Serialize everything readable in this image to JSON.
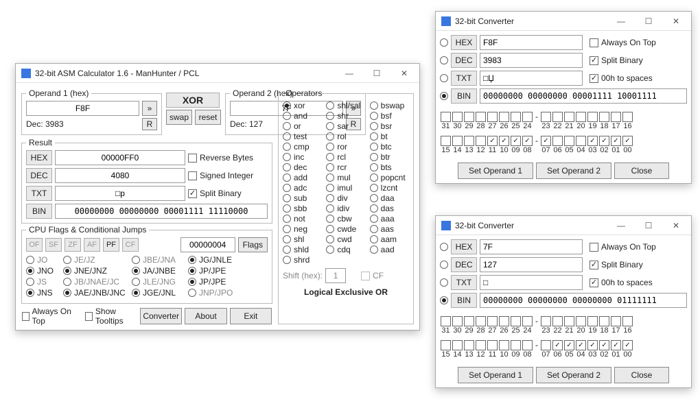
{
  "mainWin": {
    "title": "32-bit ASM Calculator 1.6 - ManHunter / PCL",
    "operand1": {
      "legend": "Operand 1 (hex)",
      "value": "F8F",
      "dec": "Dec: 3983",
      "btnR": "R",
      "btnArrow": "»"
    },
    "operator": {
      "label": "XOR",
      "swap": "swap",
      "reset": "reset"
    },
    "operand2": {
      "legend": "Operand 2 (hex)",
      "value": "7F",
      "dec": "Dec: 127",
      "btnR": "R",
      "btnArrow": "»"
    },
    "result": {
      "legend": "Result",
      "hexLabel": "HEX",
      "hex": "00000FF0",
      "decLabel": "DEC",
      "dec": "4080",
      "txtLabel": "TXT",
      "txt": "□p",
      "binLabel": "BIN",
      "bin": "00000000 00000000 00001111 11110000",
      "reverse": "Reverse Bytes",
      "signed": "Signed Integer",
      "split": "Split Binary"
    },
    "cpu": {
      "legend": "CPU Flags & Conditional Jumps",
      "flags": [
        "OF",
        "SF",
        "ZF",
        "AF",
        "PF",
        "CF"
      ],
      "activeFlags": [
        "PF"
      ],
      "counter": "00000004",
      "flagsBtn": "Flags",
      "jumps": [
        [
          [
            "JO",
            false
          ],
          [
            "JE/JZ",
            false
          ],
          [
            "JBE/JNA",
            false
          ],
          [
            "JG/JNLE",
            true
          ]
        ],
        [
          [
            "JNO",
            true
          ],
          [
            "JNE/JNZ",
            true
          ],
          [
            "JA/JNBE",
            true
          ],
          [
            "JP/JPE",
            true
          ]
        ],
        [
          [
            "JS",
            false
          ],
          [
            "JB/JNAE/JC",
            false
          ],
          [
            "JLE/JNG",
            false
          ],
          [
            "JP/JPE",
            true
          ]
        ],
        [
          [
            "JNS",
            true
          ],
          [
            "JAE/JNB/JNC",
            true
          ],
          [
            "JGE/JNL",
            true
          ],
          [
            "JNP/JPO",
            false
          ]
        ]
      ]
    },
    "operators": {
      "legend": "Operators",
      "list": [
        "xor",
        "and",
        "or",
        "test",
        "cmp",
        "inc",
        "dec",
        "add",
        "adc",
        "sub",
        "sbb",
        "not",
        "neg",
        "shl",
        "shld",
        "shrd",
        "shl/sal",
        "shr",
        "sar",
        "rol",
        "ror",
        "rcl",
        "rcr",
        "mul",
        "imul",
        "div",
        "idiv",
        "cbw",
        "cwde",
        "cwd",
        "cdq",
        "bswap",
        "bsf",
        "bsr",
        "bt",
        "btc",
        "btr",
        "bts",
        "popcnt",
        "lzcnt",
        "daa",
        "das",
        "aaa",
        "aas",
        "aam",
        "aad"
      ],
      "cols": [
        [
          "xor",
          "and",
          "or",
          "test",
          "cmp",
          "inc",
          "dec",
          "add",
          "adc",
          "sub",
          "sbb",
          "not",
          "neg",
          "shl",
          "shld",
          "shrd"
        ],
        [
          "shl/sal",
          "shr",
          "sar",
          "rol",
          "ror",
          "rcl",
          "rcr",
          "mul",
          "imul",
          "div",
          "idiv",
          "cbw",
          "cwde",
          "cwd",
          "cdq"
        ],
        [
          "bswap",
          "bsf",
          "bsr",
          "bt",
          "btc",
          "btr",
          "bts",
          "popcnt",
          "lzcnt",
          "daa",
          "das",
          "aaa",
          "aas",
          "aam",
          "aad"
        ]
      ],
      "selected": "xor",
      "shiftLabel": "Shift (hex):",
      "shiftVal": "1",
      "cfLabel": "CF",
      "desc": "Logical Exclusive OR"
    },
    "bottom": {
      "alwaysOnTop": "Always On Top",
      "tooltips": "Show Tooltips",
      "converter": "Converter",
      "about": "About",
      "exit": "Exit"
    }
  },
  "convA": {
    "title": "32-bit Converter",
    "hex": "F8F",
    "dec": "3983",
    "txt": "□Џ",
    "bin": "00000000 00000000 00001111 10001111",
    "alwaysOnTop": "Always On Top",
    "split": "Split Binary",
    "zeroH": "00h to spaces",
    "labels": {
      "hex": "HEX",
      "dec": "DEC",
      "txt": "TXT",
      "bin": "BIN"
    },
    "bitsHigh": [
      0,
      0,
      0,
      0,
      0,
      0,
      0,
      0,
      0,
      0,
      0,
      0,
      0,
      0,
      0,
      0
    ],
    "bitsLow": [
      0,
      0,
      0,
      0,
      1,
      1,
      1,
      1,
      1,
      0,
      0,
      0,
      1,
      1,
      1,
      1
    ],
    "highLbl": [
      "31",
      "30",
      "29",
      "28",
      "27",
      "26",
      "25",
      "24",
      "23",
      "22",
      "21",
      "20",
      "19",
      "18",
      "17",
      "16"
    ],
    "lowLbl": [
      "15",
      "14",
      "13",
      "12",
      "11",
      "10",
      "09",
      "08",
      "07",
      "06",
      "05",
      "04",
      "03",
      "02",
      "01",
      "00"
    ],
    "set1": "Set Operand 1",
    "set2": "Set Operand 2",
    "close": "Close",
    "selectedRow": 3
  },
  "convB": {
    "title": "32-bit Converter",
    "hex": "7F",
    "dec": "127",
    "txt": "□",
    "bin": "00000000 00000000 00000000 01111111",
    "alwaysOnTop": "Always On Top",
    "split": "Split Binary",
    "zeroH": "00h to spaces",
    "labels": {
      "hex": "HEX",
      "dec": "DEC",
      "txt": "TXT",
      "bin": "BIN"
    },
    "bitsHigh": [
      0,
      0,
      0,
      0,
      0,
      0,
      0,
      0,
      0,
      0,
      0,
      0,
      0,
      0,
      0,
      0
    ],
    "bitsLow": [
      0,
      0,
      0,
      0,
      0,
      0,
      0,
      0,
      0,
      1,
      1,
      1,
      1,
      1,
      1,
      1
    ],
    "highLbl": [
      "31",
      "30",
      "29",
      "28",
      "27",
      "26",
      "25",
      "24",
      "23",
      "22",
      "21",
      "20",
      "19",
      "18",
      "17",
      "16"
    ],
    "lowLbl": [
      "15",
      "14",
      "13",
      "12",
      "11",
      "10",
      "09",
      "08",
      "07",
      "06",
      "05",
      "04",
      "03",
      "02",
      "01",
      "00"
    ],
    "set1": "Set Operand 1",
    "set2": "Set Operand 2",
    "close": "Close",
    "selectedRow": 3
  },
  "chart_data": null
}
